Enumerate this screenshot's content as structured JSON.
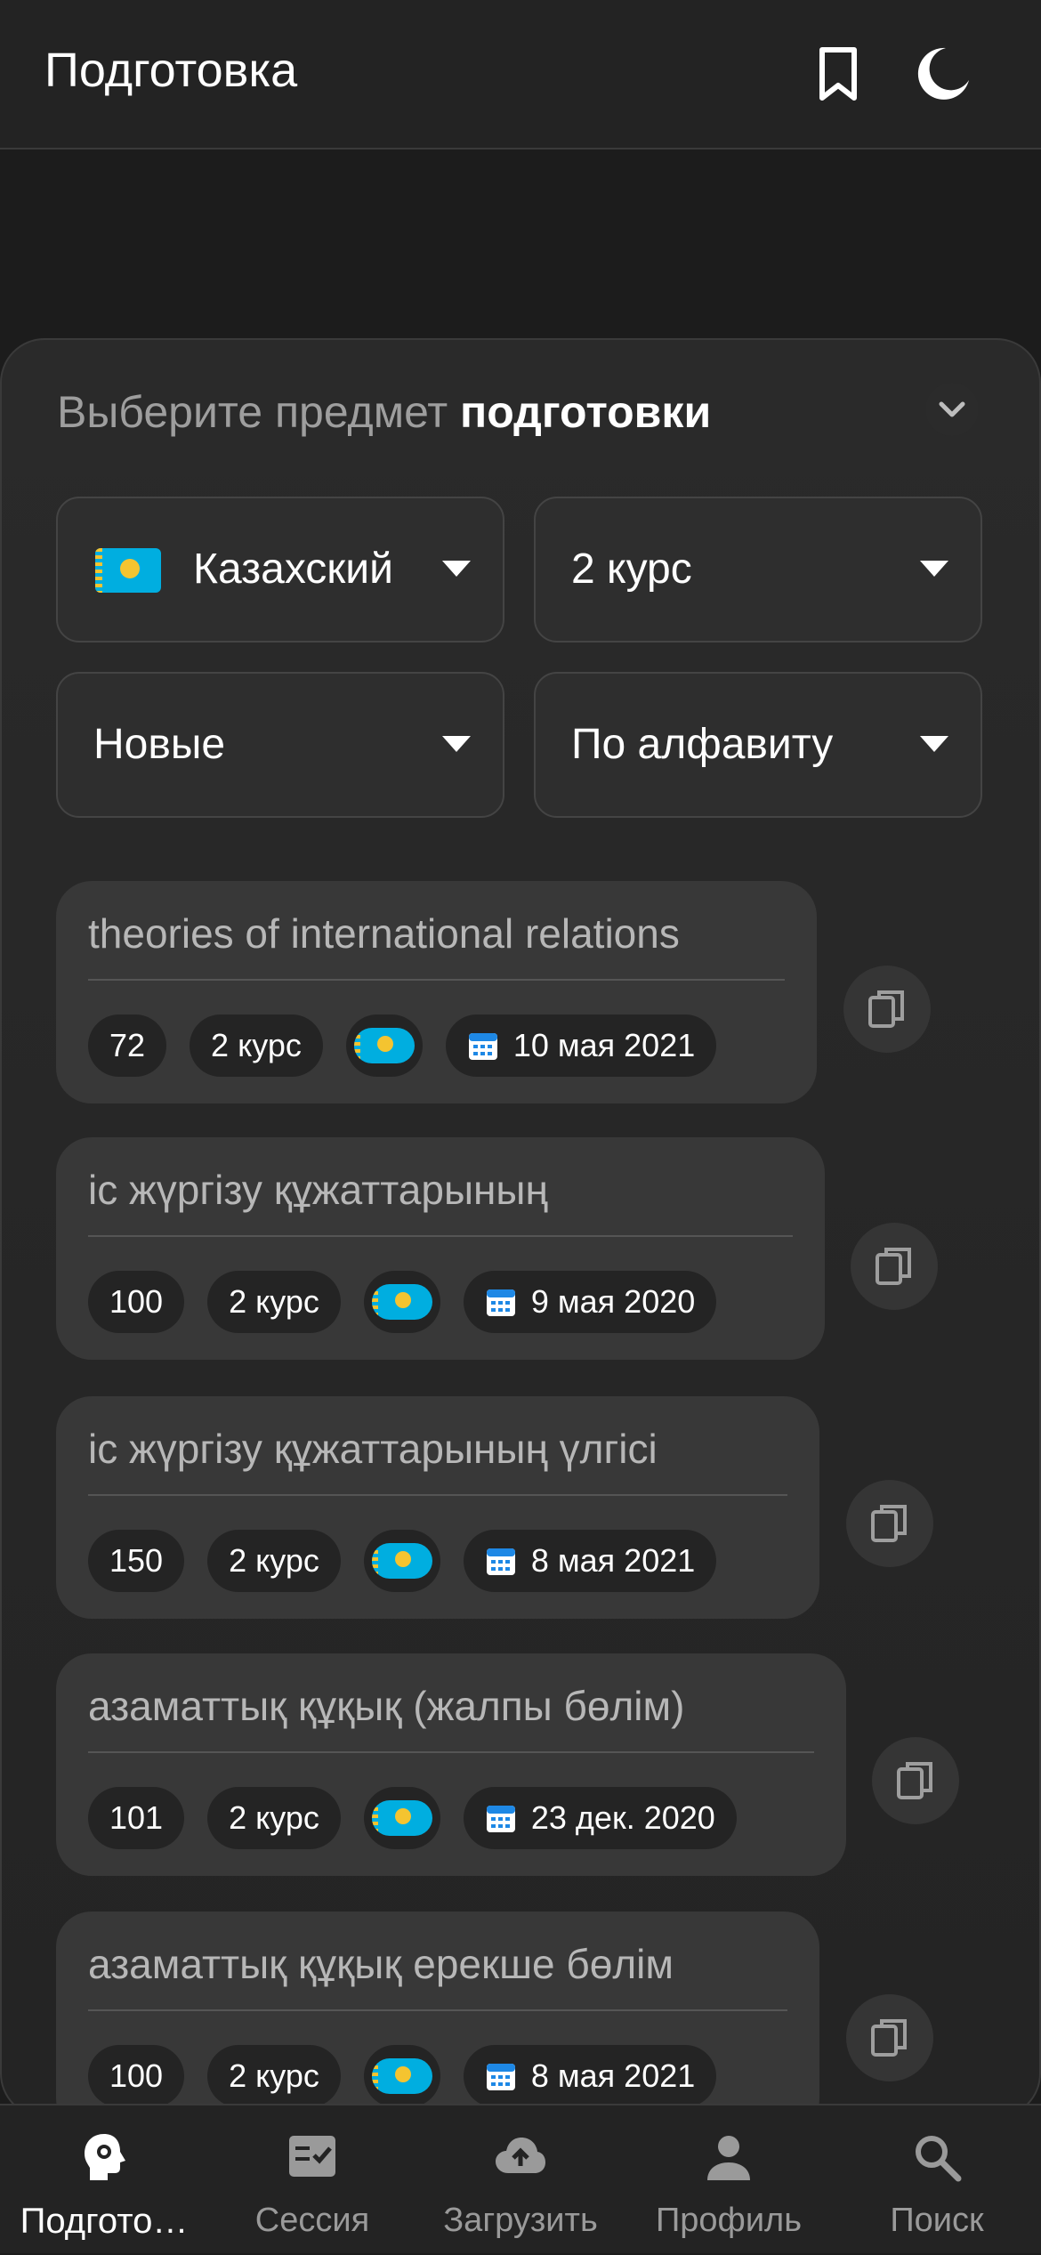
{
  "header": {
    "title": "Подготовка",
    "bookmark_icon": "bookmark-icon",
    "theme_icon": "moon-icon"
  },
  "panel": {
    "heading_prefix": "Выберите предмет ",
    "heading_bold": "подготовки",
    "collapse_icon": "chevron-down-icon"
  },
  "filters": {
    "language": "Казахский",
    "course": "2 курс",
    "status": "Новые",
    "sort": "По алфавиту"
  },
  "subjects": [
    {
      "title": "theories of international relations",
      "count": "72",
      "course": "2 курс",
      "date": "10 мая 2021"
    },
    {
      "title": "іс жүргізу құжаттарының",
      "count": "100",
      "course": "2 курс",
      "date": "9 мая 2020"
    },
    {
      "title": "іс жүргізу құжаттарының үлгісі",
      "count": "150",
      "course": "2 курс",
      "date": "8 мая 2021"
    },
    {
      "title": "азаматтық құқық (жалпы бөлім)",
      "count": "101",
      "course": "2 курс",
      "date": "23 дек. 2020"
    },
    {
      "title": "азаматтық құқық ерекше бөлім",
      "count": "100",
      "course": "2 курс",
      "date": "8 мая 2021"
    }
  ],
  "bottom_nav": [
    {
      "label": "Подгото…",
      "icon": "brain-head-icon",
      "active": true
    },
    {
      "label": "Сессия",
      "icon": "checklist-icon",
      "active": false
    },
    {
      "label": "Загрузить",
      "icon": "cloud-upload-icon",
      "active": false
    },
    {
      "label": "Профиль",
      "icon": "person-icon",
      "active": false
    },
    {
      "label": "Поиск",
      "icon": "search-icon",
      "active": false
    }
  ],
  "colors": {
    "background": "#1c1c1c",
    "card": "#383838",
    "chip": "#242424",
    "flag_blue": "#00aee0",
    "flag_gold": "#f4c430",
    "calendar_blue": "#1e88e5"
  }
}
